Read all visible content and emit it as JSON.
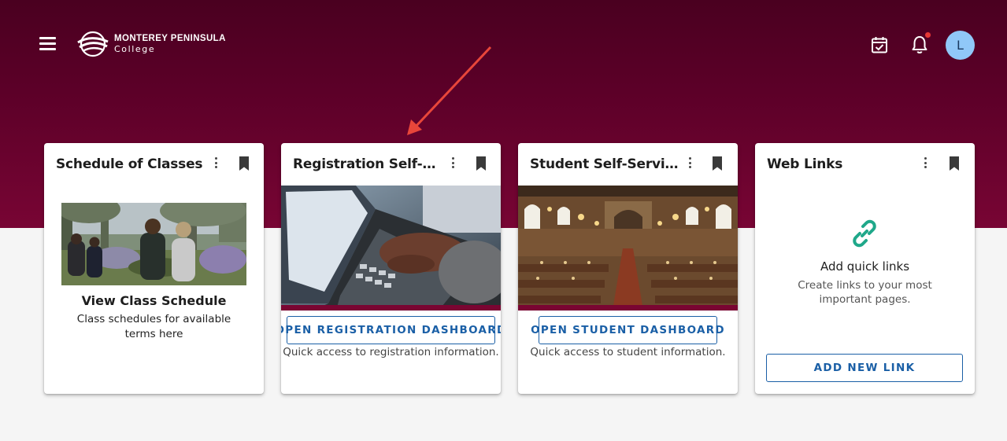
{
  "header": {
    "logo_name": "MONTEREY PENINSULA",
    "logo_sub": "College",
    "avatar_initial": "L"
  },
  "cards": [
    {
      "title": "Schedule of Classes",
      "heading": "View Class Schedule",
      "description": "Class schedules for available terms here"
    },
    {
      "title": "Registration Self-Service",
      "button_label": "OPEN REGISTRATION DASHBOARD",
      "description": "Quick access to registration information."
    },
    {
      "title": "Student Self-Service",
      "button_label": "OPEN STUDENT DASHBOARD",
      "description": "Quick access to student information."
    },
    {
      "title": "Web Links",
      "heading": "Add quick links",
      "description": "Create links to your most important pages.",
      "button_label": "ADD NEW LINK"
    }
  ],
  "colors": {
    "brand": "#5c0028",
    "accent_blue": "#1a5fa6",
    "link_icon": "#1fa88a",
    "notification": "#e53935",
    "annotation_arrow": "#e8463a"
  },
  "icons": [
    "menu-icon",
    "college-logo-icon",
    "calendar-check-icon",
    "bell-icon",
    "more-vert-icon",
    "bookmark-icon",
    "link-icon"
  ]
}
